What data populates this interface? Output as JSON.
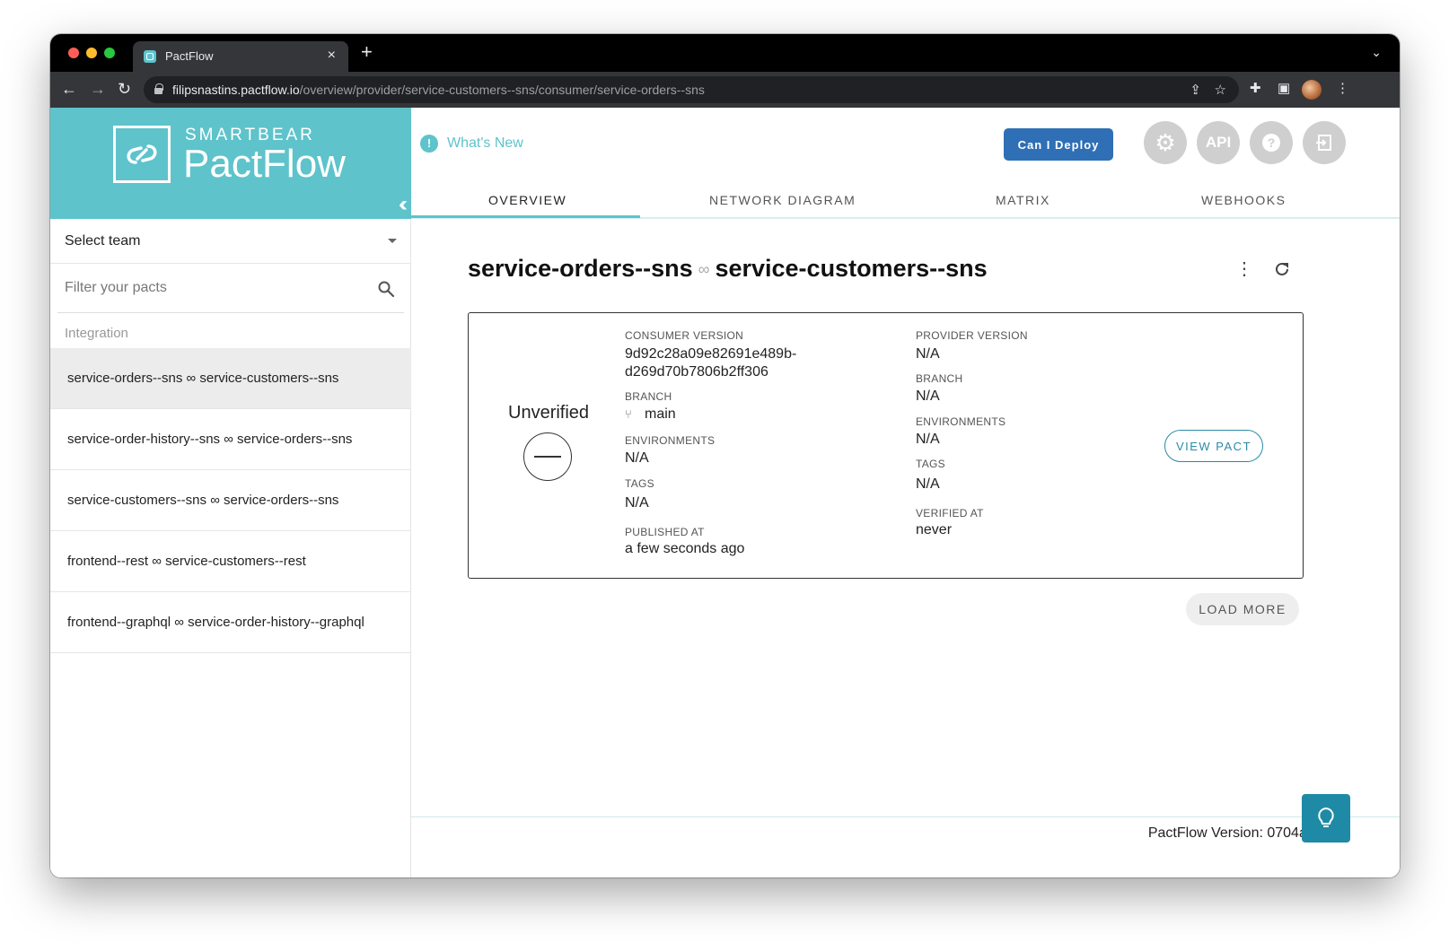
{
  "browser": {
    "tab_title": "PactFlow",
    "tab_close": "×",
    "new_tab": "+",
    "url_host": "filipsnastins.pactflow.io",
    "url_path": "/overview/provider/service-customers--sns/consumer/service-orders--sns"
  },
  "brand": {
    "company": "SMARTBEAR",
    "product": "PactFlow",
    "collapse_icon": "chevron-double-left-icon"
  },
  "sidebar": {
    "team_select": "Select team",
    "filter_placeholder": "Filter your pacts",
    "section_label": "Integration",
    "items": [
      {
        "label": "service-orders--sns ∞ service-customers--sns",
        "active": true
      },
      {
        "label": "service-order-history--sns ∞ service-orders--sns",
        "active": false
      },
      {
        "label": "service-customers--sns ∞ service-orders--sns",
        "active": false
      },
      {
        "label": "frontend--rest ∞ service-customers--rest",
        "active": false
      },
      {
        "label": "frontend--graphql ∞ service-order-history--graphql",
        "active": false
      }
    ]
  },
  "header": {
    "whats_new": "What's New",
    "can_i_deploy": "Can I Deploy",
    "api_label": "API",
    "help_label": "?"
  },
  "tabs": [
    "OVERVIEW",
    "NETWORK DIAGRAM",
    "MATRIX",
    "WEBHOOKS"
  ],
  "pair": {
    "consumer": "service-orders--sns",
    "provider": "service-customers--sns"
  },
  "card": {
    "status": "Unverified",
    "consumer": {
      "version_label": "CONSUMER VERSION",
      "version_line1": "9d92c28a09e82691e489b-",
      "version_line2": "d269d70b7806b2ff306",
      "branch_label": "BRANCH",
      "branch": "main",
      "environments_label": "ENVIRONMENTS",
      "environments": "N/A",
      "tags_label": "TAGS",
      "tags": "N/A",
      "published_label": "PUBLISHED AT",
      "published": "a few seconds ago"
    },
    "provider": {
      "version_label": "PROVIDER VERSION",
      "version": "N/A",
      "branch_label": "BRANCH",
      "branch": "N/A",
      "environments_label": "ENVIRONMENTS",
      "environments": "N/A",
      "tags_label": "TAGS",
      "tags": "N/A",
      "verified_label": "VERIFIED AT",
      "verified": "never"
    },
    "view_pact": "VIEW PACT"
  },
  "load_more": "LOAD MORE",
  "footer": {
    "version": "PactFlow Version: 0704a4f82"
  },
  "colors": {
    "brand_teal": "#5ec3cb",
    "deploy_blue": "#2f6fb5",
    "hint_button": "#1f8aa6"
  }
}
